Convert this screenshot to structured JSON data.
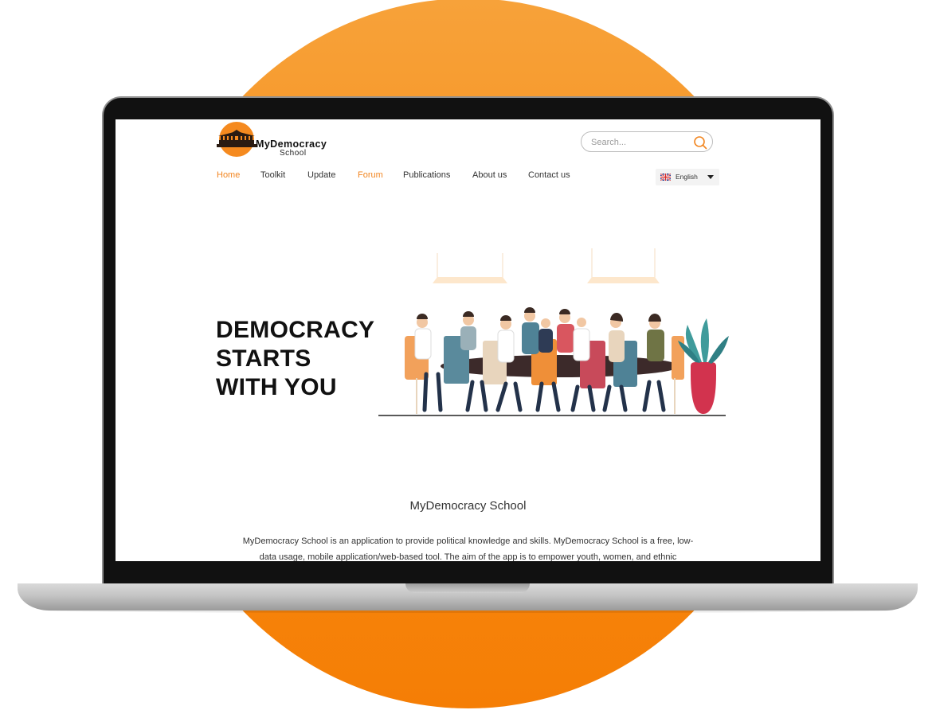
{
  "brand": {
    "name": "MyDemocracy",
    "sub": "School",
    "accent": "#f2851f"
  },
  "search": {
    "placeholder": "Search..."
  },
  "nav": {
    "items": [
      {
        "label": "Home",
        "active": true
      },
      {
        "label": "Toolkit",
        "active": false
      },
      {
        "label": "Update",
        "active": false
      },
      {
        "label": "Forum",
        "active": true
      },
      {
        "label": "Publications",
        "active": false
      },
      {
        "label": "About us",
        "active": false
      },
      {
        "label": "Contact us",
        "active": false
      }
    ]
  },
  "language": {
    "selected": "English",
    "icon": "uk-flag-icon"
  },
  "hero": {
    "lines": [
      "DEMOCRACY",
      "STARTS",
      "WITH YOU"
    ]
  },
  "section": {
    "title": "MyDemocracy School",
    "description": "MyDemocracy School is an application to provide political knowledge and skills. MyDemocracy School is a free, low-data usage, mobile application/web-based tool. The aim of the app is to empower youth, women, and ethnic"
  }
}
